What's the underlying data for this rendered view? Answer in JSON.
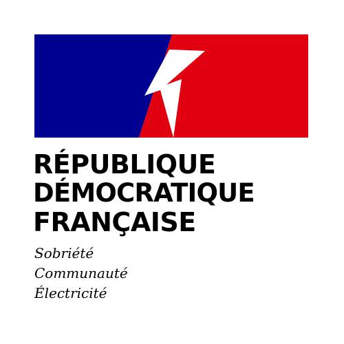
{
  "logo": {
    "colors": {
      "blue": "#000091",
      "red": "#e1000f",
      "bolt": "#ffffff"
    },
    "bolt_icon": "lightning-bolt-icon",
    "title_lines": [
      "RÉPUBLIQUE",
      "DÉMOCRATIQUE",
      "FRANÇAISE"
    ],
    "motto_lines": [
      "Sobriété",
      "Communauté",
      "Électricité"
    ]
  }
}
